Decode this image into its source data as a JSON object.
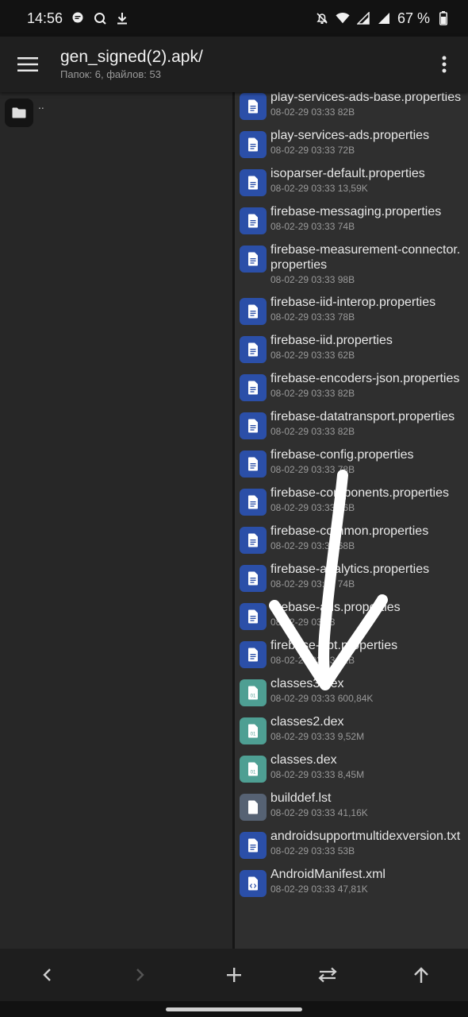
{
  "status_bar": {
    "time": "14:56",
    "battery_percent": "67 %",
    "left_icons": [
      "chat-bubble-icon",
      "search-app-icon",
      "download-icon"
    ],
    "right_icons": [
      "dnd-icon",
      "wifi-icon",
      "signal-icon",
      "signal-icon",
      "battery-icon"
    ]
  },
  "app_bar": {
    "title": "gen_signed(2).apk/",
    "subtitle": "Папок: 6, файлов: 53",
    "menu_icon": "hamburger-menu-icon",
    "more_icon": "more-vertical-icon"
  },
  "left_pane": {
    "up_label": ".."
  },
  "files": [
    {
      "name": "play-services-ads-base.properties",
      "meta": "08-02-29 03:33  82B",
      "type": "doc"
    },
    {
      "name": "play-services-ads.properties",
      "meta": "08-02-29 03:33  72B",
      "type": "doc"
    },
    {
      "name": "isoparser-default.properties",
      "meta": "08-02-29 03:33  13,59K",
      "type": "doc"
    },
    {
      "name": "firebase-messaging.properties",
      "meta": "08-02-29 03:33  74B",
      "type": "doc"
    },
    {
      "name": "firebase-measurement-connector.properties",
      "meta": "08-02-29 03:33  98B",
      "type": "doc"
    },
    {
      "name": "firebase-iid-interop.properties",
      "meta": "08-02-29 03:33  78B",
      "type": "doc"
    },
    {
      "name": "firebase-iid.properties",
      "meta": "08-02-29 03:33  62B",
      "type": "doc"
    },
    {
      "name": "firebase-encoders-json.properties",
      "meta": "08-02-29 03:33  82B",
      "type": "doc"
    },
    {
      "name": "firebase-datatransport.properties",
      "meta": "08-02-29 03:33  82B",
      "type": "doc"
    },
    {
      "name": "firebase-config.properties",
      "meta": "08-02-29 03:33  78B",
      "type": "doc"
    },
    {
      "name": "firebase-components.properties",
      "meta": "08-02-29 03:33  76B",
      "type": "doc"
    },
    {
      "name": "firebase-common.properties",
      "meta": "08-02-29 03:33  68B",
      "type": "doc"
    },
    {
      "name": "firebase-analytics.properties",
      "meta": "08-02-29 03:33  74B",
      "type": "doc"
    },
    {
      "name": "firebase-ads.properties",
      "meta": "08-02-29 03:33  ",
      "type": "doc"
    },
    {
      "name": "firebase-abt.properties",
      "meta": "08-02-29 03:33  62B",
      "type": "doc"
    },
    {
      "name": "classes3.dex",
      "meta": "08-02-29 03:33  600,84K",
      "type": "dex"
    },
    {
      "name": "classes2.dex",
      "meta": "08-02-29 03:33  9,52M",
      "type": "dex"
    },
    {
      "name": "classes.dex",
      "meta": "08-02-29 03:33  8,45M",
      "type": "dex"
    },
    {
      "name": "builddef.lst",
      "meta": "08-02-29 03:33  41,16K",
      "type": "lst"
    },
    {
      "name": "androidsupportmultidexversion.txt",
      "meta": "08-02-29 03:33  53B",
      "type": "doc"
    },
    {
      "name": "AndroidManifest.xml",
      "meta": "08-02-29 03:33  47,81K",
      "type": "xml"
    }
  ],
  "bottom_bar": {
    "buttons": [
      "back-icon",
      "forward-icon",
      "add-icon",
      "swap-panes-icon",
      "parent-folder-icon"
    ]
  },
  "colors": {
    "doc_icon": "#2b4fa8",
    "dex_icon": "#4e9f93",
    "lst_icon": "#566273",
    "annotation_arrow": "#ffffff"
  },
  "annotation": "hand-drawn-arrow-pointing-down"
}
